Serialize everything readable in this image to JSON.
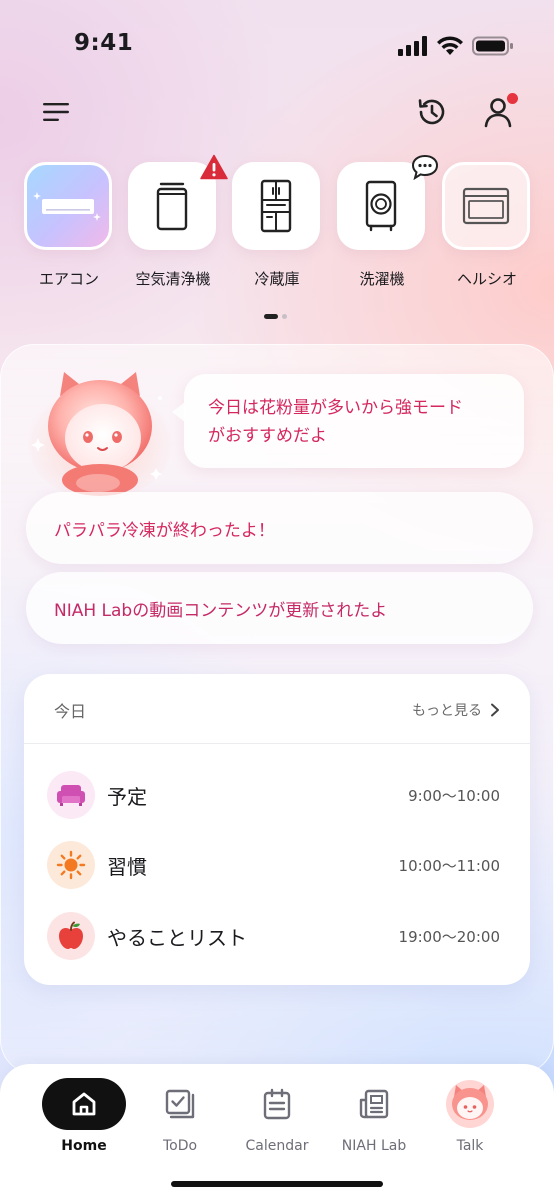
{
  "status_bar": {
    "time": "9:41"
  },
  "devices": [
    {
      "label": "エアコン",
      "icon": "air-conditioner-icon",
      "active": true
    },
    {
      "label": "空気清浄機",
      "icon": "air-purifier-icon",
      "badge": "warning-icon"
    },
    {
      "label": "冷蔵庫",
      "icon": "refrigerator-icon"
    },
    {
      "label": "洗濯機",
      "icon": "washing-machine-icon",
      "badge": "chat-bubble-icon"
    },
    {
      "label": "ヘルシオ",
      "icon": "microwave-oven-icon"
    }
  ],
  "pager": {
    "pages": 2,
    "current": 1
  },
  "assistant": {
    "message": "今日は花粉量が多いから強モード\nがおすすめだよ",
    "notices": [
      "パラパラ冷凍が終わったよ！",
      "NIAH Labの動画コンテンツが更新されたよ"
    ]
  },
  "today": {
    "title": "今日",
    "more_label": "もっと見る",
    "items": [
      {
        "label": "予定",
        "time": "9:00〜10:00",
        "icon": "sofa-icon"
      },
      {
        "label": "習慣",
        "time": "10:00〜11:00",
        "icon": "sun-icon"
      },
      {
        "label": "やることリスト",
        "time": "19:00〜20:00",
        "icon": "apple-icon"
      }
    ]
  },
  "nav": {
    "items": [
      {
        "label": "Home",
        "icon": "home-icon",
        "active": true
      },
      {
        "label": "ToDo",
        "icon": "checklist-icon"
      },
      {
        "label": "Calendar",
        "icon": "calendar-icon"
      },
      {
        "label": "NIAH Lab",
        "icon": "newspaper-icon"
      },
      {
        "label": "Talk",
        "icon": "mascot-avatar-icon"
      }
    ]
  },
  "colors": {
    "accent_pink": "#d4285f",
    "warning_red": "#d92b3a",
    "nav_active": "#111111"
  }
}
